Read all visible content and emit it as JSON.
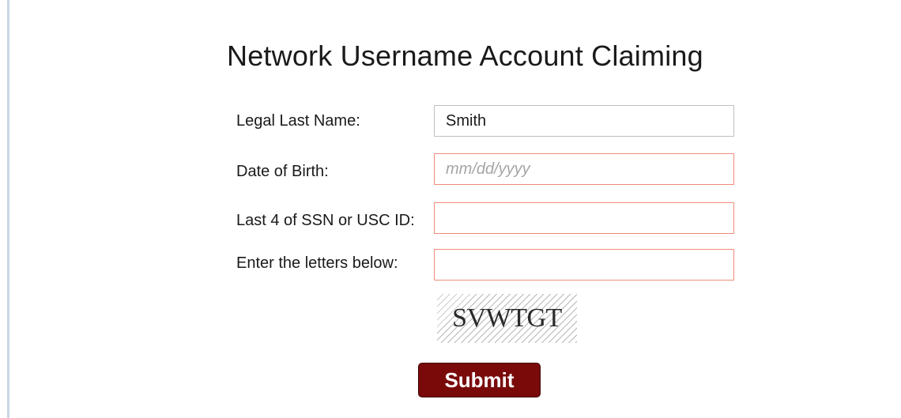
{
  "form": {
    "title": "Network Username Account Claiming",
    "last_name": {
      "label": "Legal Last Name:",
      "value": "Smith",
      "placeholder": ""
    },
    "dob": {
      "label": "Date of Birth:",
      "value": "",
      "placeholder": "mm/dd/yyyy"
    },
    "ssn": {
      "label": "Last 4 of SSN or USC ID:",
      "value": "",
      "placeholder": ""
    },
    "captcha_input": {
      "label": "Enter the letters below:",
      "value": "",
      "placeholder": ""
    },
    "captcha": {
      "text": "SVWTGT"
    },
    "submit_label": "Submit"
  },
  "colors": {
    "submit_bg": "#7a0a0a",
    "invalid_border": "#f08a78",
    "left_rule": "#c9d6e6"
  }
}
